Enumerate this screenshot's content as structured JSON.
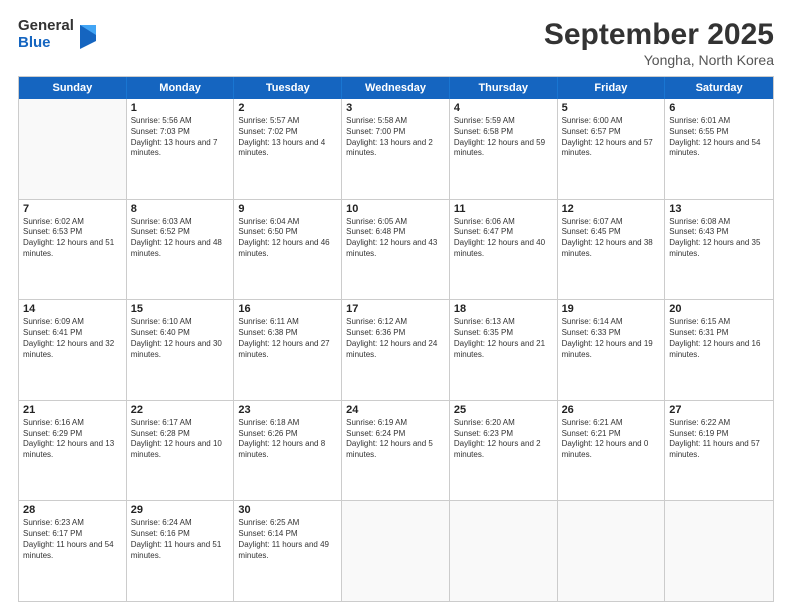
{
  "logo": {
    "general": "General",
    "blue": "Blue"
  },
  "title": "September 2025",
  "subtitle": "Yongha, North Korea",
  "header": {
    "days": [
      "Sunday",
      "Monday",
      "Tuesday",
      "Wednesday",
      "Thursday",
      "Friday",
      "Saturday"
    ]
  },
  "weeks": [
    [
      {
        "day": "",
        "sunrise": "",
        "sunset": "",
        "daylight": ""
      },
      {
        "day": "1",
        "sunrise": "Sunrise: 5:56 AM",
        "sunset": "Sunset: 7:03 PM",
        "daylight": "Daylight: 13 hours and 7 minutes."
      },
      {
        "day": "2",
        "sunrise": "Sunrise: 5:57 AM",
        "sunset": "Sunset: 7:02 PM",
        "daylight": "Daylight: 13 hours and 4 minutes."
      },
      {
        "day": "3",
        "sunrise": "Sunrise: 5:58 AM",
        "sunset": "Sunset: 7:00 PM",
        "daylight": "Daylight: 13 hours and 2 minutes."
      },
      {
        "day": "4",
        "sunrise": "Sunrise: 5:59 AM",
        "sunset": "Sunset: 6:58 PM",
        "daylight": "Daylight: 12 hours and 59 minutes."
      },
      {
        "day": "5",
        "sunrise": "Sunrise: 6:00 AM",
        "sunset": "Sunset: 6:57 PM",
        "daylight": "Daylight: 12 hours and 57 minutes."
      },
      {
        "day": "6",
        "sunrise": "Sunrise: 6:01 AM",
        "sunset": "Sunset: 6:55 PM",
        "daylight": "Daylight: 12 hours and 54 minutes."
      }
    ],
    [
      {
        "day": "7",
        "sunrise": "Sunrise: 6:02 AM",
        "sunset": "Sunset: 6:53 PM",
        "daylight": "Daylight: 12 hours and 51 minutes."
      },
      {
        "day": "8",
        "sunrise": "Sunrise: 6:03 AM",
        "sunset": "Sunset: 6:52 PM",
        "daylight": "Daylight: 12 hours and 48 minutes."
      },
      {
        "day": "9",
        "sunrise": "Sunrise: 6:04 AM",
        "sunset": "Sunset: 6:50 PM",
        "daylight": "Daylight: 12 hours and 46 minutes."
      },
      {
        "day": "10",
        "sunrise": "Sunrise: 6:05 AM",
        "sunset": "Sunset: 6:48 PM",
        "daylight": "Daylight: 12 hours and 43 minutes."
      },
      {
        "day": "11",
        "sunrise": "Sunrise: 6:06 AM",
        "sunset": "Sunset: 6:47 PM",
        "daylight": "Daylight: 12 hours and 40 minutes."
      },
      {
        "day": "12",
        "sunrise": "Sunrise: 6:07 AM",
        "sunset": "Sunset: 6:45 PM",
        "daylight": "Daylight: 12 hours and 38 minutes."
      },
      {
        "day": "13",
        "sunrise": "Sunrise: 6:08 AM",
        "sunset": "Sunset: 6:43 PM",
        "daylight": "Daylight: 12 hours and 35 minutes."
      }
    ],
    [
      {
        "day": "14",
        "sunrise": "Sunrise: 6:09 AM",
        "sunset": "Sunset: 6:41 PM",
        "daylight": "Daylight: 12 hours and 32 minutes."
      },
      {
        "day": "15",
        "sunrise": "Sunrise: 6:10 AM",
        "sunset": "Sunset: 6:40 PM",
        "daylight": "Daylight: 12 hours and 30 minutes."
      },
      {
        "day": "16",
        "sunrise": "Sunrise: 6:11 AM",
        "sunset": "Sunset: 6:38 PM",
        "daylight": "Daylight: 12 hours and 27 minutes."
      },
      {
        "day": "17",
        "sunrise": "Sunrise: 6:12 AM",
        "sunset": "Sunset: 6:36 PM",
        "daylight": "Daylight: 12 hours and 24 minutes."
      },
      {
        "day": "18",
        "sunrise": "Sunrise: 6:13 AM",
        "sunset": "Sunset: 6:35 PM",
        "daylight": "Daylight: 12 hours and 21 minutes."
      },
      {
        "day": "19",
        "sunrise": "Sunrise: 6:14 AM",
        "sunset": "Sunset: 6:33 PM",
        "daylight": "Daylight: 12 hours and 19 minutes."
      },
      {
        "day": "20",
        "sunrise": "Sunrise: 6:15 AM",
        "sunset": "Sunset: 6:31 PM",
        "daylight": "Daylight: 12 hours and 16 minutes."
      }
    ],
    [
      {
        "day": "21",
        "sunrise": "Sunrise: 6:16 AM",
        "sunset": "Sunset: 6:29 PM",
        "daylight": "Daylight: 12 hours and 13 minutes."
      },
      {
        "day": "22",
        "sunrise": "Sunrise: 6:17 AM",
        "sunset": "Sunset: 6:28 PM",
        "daylight": "Daylight: 12 hours and 10 minutes."
      },
      {
        "day": "23",
        "sunrise": "Sunrise: 6:18 AM",
        "sunset": "Sunset: 6:26 PM",
        "daylight": "Daylight: 12 hours and 8 minutes."
      },
      {
        "day": "24",
        "sunrise": "Sunrise: 6:19 AM",
        "sunset": "Sunset: 6:24 PM",
        "daylight": "Daylight: 12 hours and 5 minutes."
      },
      {
        "day": "25",
        "sunrise": "Sunrise: 6:20 AM",
        "sunset": "Sunset: 6:23 PM",
        "daylight": "Daylight: 12 hours and 2 minutes."
      },
      {
        "day": "26",
        "sunrise": "Sunrise: 6:21 AM",
        "sunset": "Sunset: 6:21 PM",
        "daylight": "Daylight: 12 hours and 0 minutes."
      },
      {
        "day": "27",
        "sunrise": "Sunrise: 6:22 AM",
        "sunset": "Sunset: 6:19 PM",
        "daylight": "Daylight: 11 hours and 57 minutes."
      }
    ],
    [
      {
        "day": "28",
        "sunrise": "Sunrise: 6:23 AM",
        "sunset": "Sunset: 6:17 PM",
        "daylight": "Daylight: 11 hours and 54 minutes."
      },
      {
        "day": "29",
        "sunrise": "Sunrise: 6:24 AM",
        "sunset": "Sunset: 6:16 PM",
        "daylight": "Daylight: 11 hours and 51 minutes."
      },
      {
        "day": "30",
        "sunrise": "Sunrise: 6:25 AM",
        "sunset": "Sunset: 6:14 PM",
        "daylight": "Daylight: 11 hours and 49 minutes."
      },
      {
        "day": "",
        "sunrise": "",
        "sunset": "",
        "daylight": ""
      },
      {
        "day": "",
        "sunrise": "",
        "sunset": "",
        "daylight": ""
      },
      {
        "day": "",
        "sunrise": "",
        "sunset": "",
        "daylight": ""
      },
      {
        "day": "",
        "sunrise": "",
        "sunset": "",
        "daylight": ""
      }
    ]
  ]
}
